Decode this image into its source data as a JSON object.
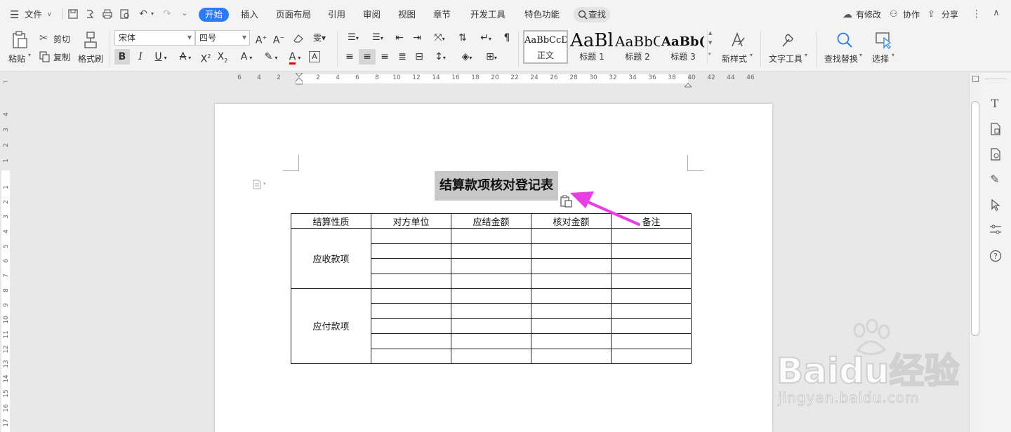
{
  "menubar": {
    "file": "文件",
    "tabs": [
      "开始",
      "插入",
      "页面布局",
      "引用",
      "审阅",
      "视图",
      "章节",
      "开发工具",
      "特色功能"
    ],
    "search": "查找",
    "has_changes": "有修改",
    "collab": "协作",
    "share": "分享"
  },
  "ribbon": {
    "paste": "粘贴",
    "cut": "剪切",
    "copy": "复制",
    "format_painter": "格式刷",
    "font_name": "宋体",
    "font_size": "四号",
    "styles": [
      {
        "sample": "AaBbCcDc",
        "name": "正文"
      },
      {
        "sample": "AaBl",
        "name": "标题 1"
      },
      {
        "sample": "AaBbC",
        "name": "标题 2"
      },
      {
        "sample": "AaBb(",
        "name": "标题 3"
      }
    ],
    "new_style": "新样式",
    "text_tools": "文字工具",
    "find_replace": "查找替换",
    "select": "选择"
  },
  "ruler": {
    "h_ticks": [
      "6",
      "4",
      "2",
      "2",
      "4",
      "6",
      "8",
      "10",
      "12",
      "14",
      "16",
      "18",
      "20",
      "22",
      "24",
      "26",
      "28",
      "30",
      "32",
      "34",
      "36",
      "38",
      "40",
      "42",
      "44",
      "46"
    ],
    "v_ticks": [
      "4",
      "3",
      "2",
      "1",
      "1",
      "2",
      "3",
      "4",
      "5",
      "6",
      "7",
      "8",
      "9",
      "10",
      "11",
      "12",
      "13",
      "14",
      "15",
      "16",
      "17"
    ]
  },
  "document": {
    "title": "结算款项核对登记表",
    "headers": [
      "结算性质",
      "对方单位",
      "应结金额",
      "核对金额",
      "备注"
    ],
    "row_group_1": "应收款项",
    "row_group_2": "应付款项"
  },
  "watermark": {
    "brand": "Baidu经验",
    "url": "jingyan.baidu.com"
  },
  "colors": {
    "accent": "#2f7bf5",
    "arrow": "#e83ee6",
    "selection": "#c8c8c8"
  }
}
